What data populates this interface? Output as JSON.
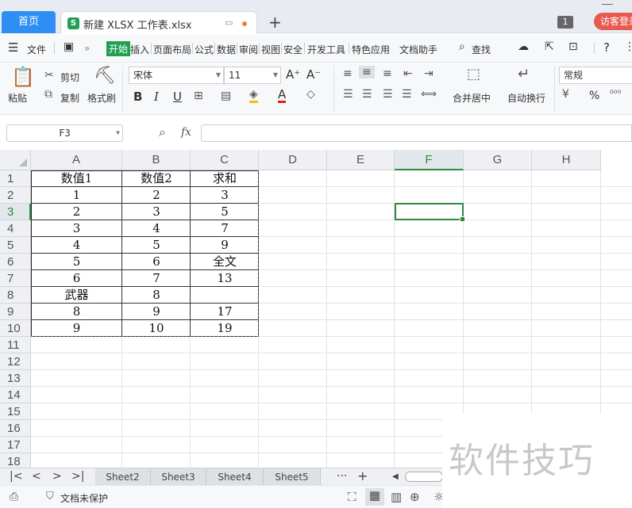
{
  "tabbar": {
    "home_label": "首页",
    "file_tab_label": "新建 XLSX 工作表.xlsx",
    "file_icon": "S",
    "new_tab_label": "+",
    "window_count": "1",
    "login_label": "访客登录"
  },
  "menubar": {
    "items": [
      "文件",
      "开始",
      "插入",
      "页面布局",
      "公式",
      "数据",
      "审阅",
      "视图",
      "安全",
      "开发工具",
      "特色应用",
      "文档助手",
      "查找"
    ],
    "active_index": 1,
    "more_glyph": "»"
  },
  "ribbon": {
    "paste_label": "粘贴",
    "cut_label": "剪切",
    "copy_label": "复制",
    "format_painter_label": "格式刷",
    "font_name": "宋体",
    "font_size": "11",
    "merge_center_label": "合并居中",
    "wrap_text_label": "自动换行",
    "number_format": "常规",
    "bold": "B",
    "italic": "I",
    "underline": "U",
    "font_color_glyph": "A",
    "grow_font": "A⁺",
    "shrink_font": "A⁻",
    "percent": "%"
  },
  "formula_bar": {
    "name_box": "F3",
    "fx_label": "fx",
    "formula": ""
  },
  "sheet": {
    "columns": [
      "A",
      "B",
      "C",
      "D",
      "E",
      "F",
      "G",
      "H"
    ],
    "selected_column": "F",
    "rows": [
      "1",
      "2",
      "3",
      "4",
      "5",
      "6",
      "7",
      "8",
      "9",
      "10",
      "11",
      "12",
      "13",
      "14",
      "15",
      "16",
      "17",
      "18"
    ],
    "selected_row": "3",
    "cells": [
      [
        "数值1",
        "数值2",
        "求和"
      ],
      [
        "1",
        "2",
        "3"
      ],
      [
        "2",
        "3",
        "5"
      ],
      [
        "3",
        "4",
        "7"
      ],
      [
        "4",
        "5",
        "9"
      ],
      [
        "5",
        "6",
        "全文"
      ],
      [
        "6",
        "7",
        "13"
      ],
      [
        "武器",
        "8",
        ""
      ],
      [
        "8",
        "9",
        "17"
      ],
      [
        "9",
        "10",
        "19"
      ]
    ]
  },
  "sheet_tabs": [
    "Sheet2",
    "Sheet3",
    "Sheet4",
    "Sheet5"
  ],
  "sheet_nav": {
    "first": "K",
    "prev": "<",
    "next": ">",
    "last": "›I",
    "more": "···",
    "add": "+"
  },
  "status": {
    "protect_label": "文档未保护"
  },
  "watermark": "软件技巧",
  "colors": {
    "accent_green": "#2e8b3c",
    "home_tab_blue": "#2f8ef4",
    "login_red": "#e85a4f",
    "start_green": "#22a052"
  }
}
